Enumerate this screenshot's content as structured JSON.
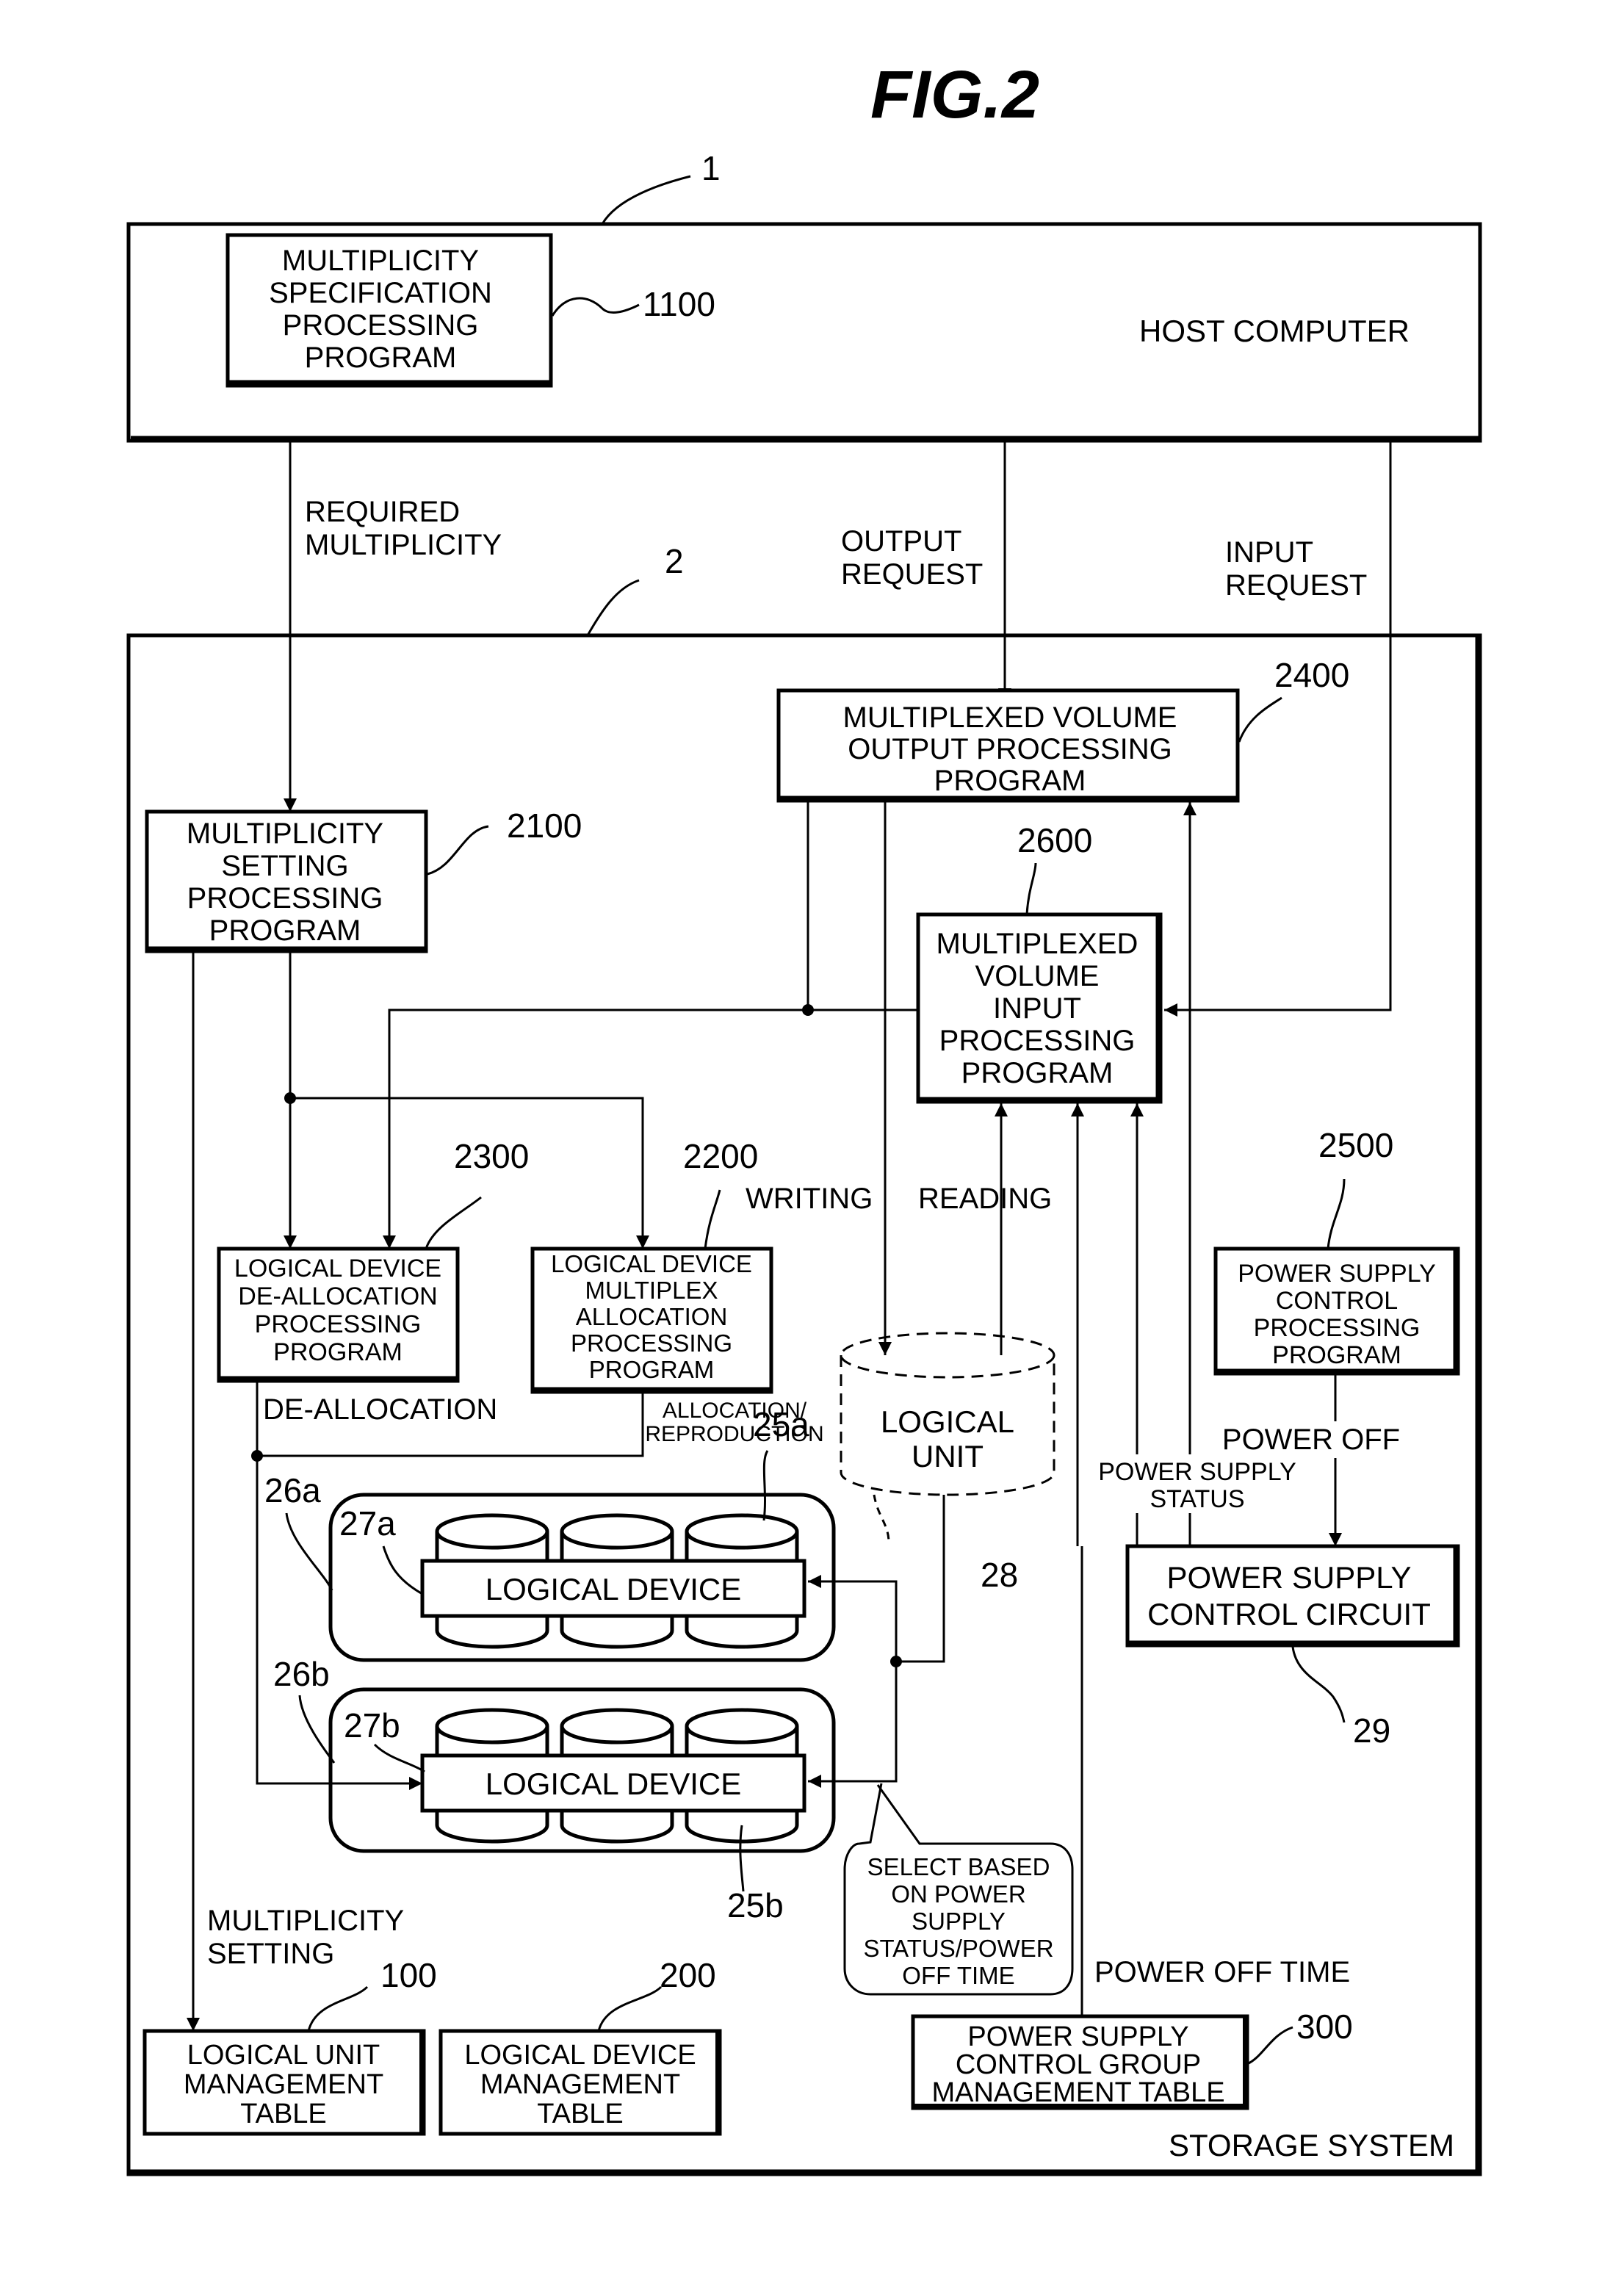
{
  "figure": {
    "title": "FIG.2"
  },
  "refs": {
    "host": "1",
    "storage": "2",
    "msp": "1100",
    "msetp": "2100",
    "dealloc": "2300",
    "alloc": "2200",
    "output": "2400",
    "input": "2600",
    "psprog": "2500",
    "luref": "28",
    "psc": "29",
    "g26a": "26a",
    "g26b": "26b",
    "l27a": "27a",
    "l27b": "27b",
    "d25a": "25a",
    "d25b": "25b",
    "lut": "100",
    "ldt": "200",
    "pscg": "300"
  },
  "host": {
    "label": "HOST COMPUTER"
  },
  "storage": {
    "label": "STORAGE SYSTEM"
  },
  "boxes": {
    "msp": [
      "MULTIPLICITY",
      "SPECIFICATION",
      "PROCESSING",
      "PROGRAM"
    ],
    "msetp": [
      "MULTIPLICITY",
      "SETTING",
      "PROCESSING",
      "PROGRAM"
    ],
    "output": [
      "MULTIPLEXED VOLUME",
      "OUTPUT PROCESSING",
      "PROGRAM"
    ],
    "input": [
      "MULTIPLEXED",
      "VOLUME",
      "INPUT",
      "PROCESSING",
      "PROGRAM"
    ],
    "dealloc": [
      "LOGICAL DEVICE",
      "DE-ALLOCATION",
      "PROCESSING",
      "PROGRAM"
    ],
    "alloc": [
      "LOGICAL DEVICE",
      "MULTIPLEX",
      "ALLOCATION",
      "PROCESSING",
      "PROGRAM"
    ],
    "psprog": [
      "POWER SUPPLY",
      "CONTROL",
      "PROCESSING",
      "PROGRAM"
    ],
    "psc": [
      "POWER SUPPLY",
      "CONTROL CIRCUIT"
    ],
    "lu": [
      "LOGICAL",
      "UNIT"
    ],
    "ld_a": "LOGICAL DEVICE",
    "ld_b": "LOGICAL DEVICE",
    "lut": [
      "LOGICAL UNIT",
      "MANAGEMENT",
      "TABLE"
    ],
    "ldt": [
      "LOGICAL DEVICE",
      "MANAGEMENT",
      "TABLE"
    ],
    "pscg": [
      "POWER SUPPLY",
      "CONTROL GROUP",
      "MANAGEMENT TABLE"
    ],
    "select": [
      "SELECT BASED",
      "ON POWER",
      "SUPPLY",
      "STATUS/POWER",
      "OFF TIME"
    ]
  },
  "flows": {
    "required": [
      "REQUIRED",
      "MULTIPLICITY"
    ],
    "output_req": [
      "OUTPUT",
      "REQUEST"
    ],
    "input_req": [
      "INPUT",
      "REQUEST"
    ],
    "writing": "WRITING",
    "reading": "READING",
    "dealloc": "DE-ALLOCATION",
    "alloc": [
      "ALLOCATION/",
      "REPRODUCTION"
    ],
    "power_off": "POWER OFF",
    "ps_status": [
      "POWER SUPPLY",
      "STATUS"
    ],
    "power_off_time": "POWER OFF TIME",
    "mult_setting": [
      "MULTIPLICITY",
      "SETTING"
    ]
  }
}
